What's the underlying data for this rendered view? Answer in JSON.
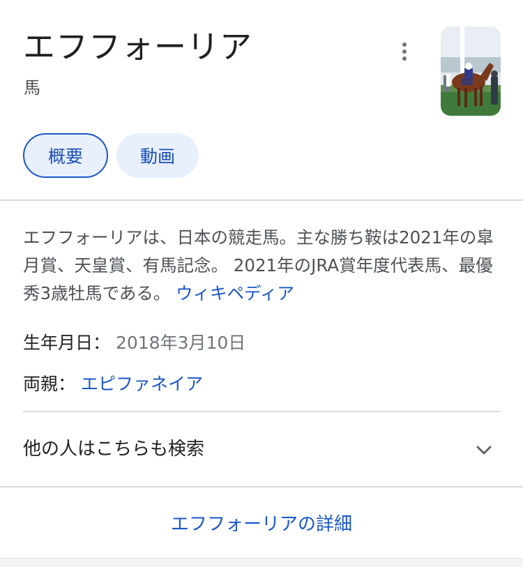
{
  "entity": {
    "title": "エフフォーリア",
    "type": "馬"
  },
  "icons": {
    "more": "more-vert-icon",
    "expand": "chevron-down-icon"
  },
  "tabs": [
    {
      "label": "概要",
      "active": true
    },
    {
      "label": "動画",
      "active": false
    }
  ],
  "description": {
    "text": "エフフォーリアは、日本の競走馬。主な勝ち鞍は2021年の皐月賞、天皇賞、有馬記念。 2021年のJRA賞年度代表馬、最優秀3歳牡馬である。 ",
    "source_link": "ウィキペディア"
  },
  "facts": [
    {
      "label": "生年月日",
      "value": "2018年3月10日"
    },
    {
      "label": "両親",
      "value": "エピファネイア"
    }
  ],
  "people_also_search": {
    "label": "他の人はこちらも検索"
  },
  "more_about": {
    "label": "エフフォーリアの詳細"
  },
  "colors": {
    "link": "#1a56c8",
    "chip_bg": "#e8f0fe",
    "divider": "#dadce0",
    "text_primary": "#202124",
    "text_secondary": "#4d5156"
  }
}
